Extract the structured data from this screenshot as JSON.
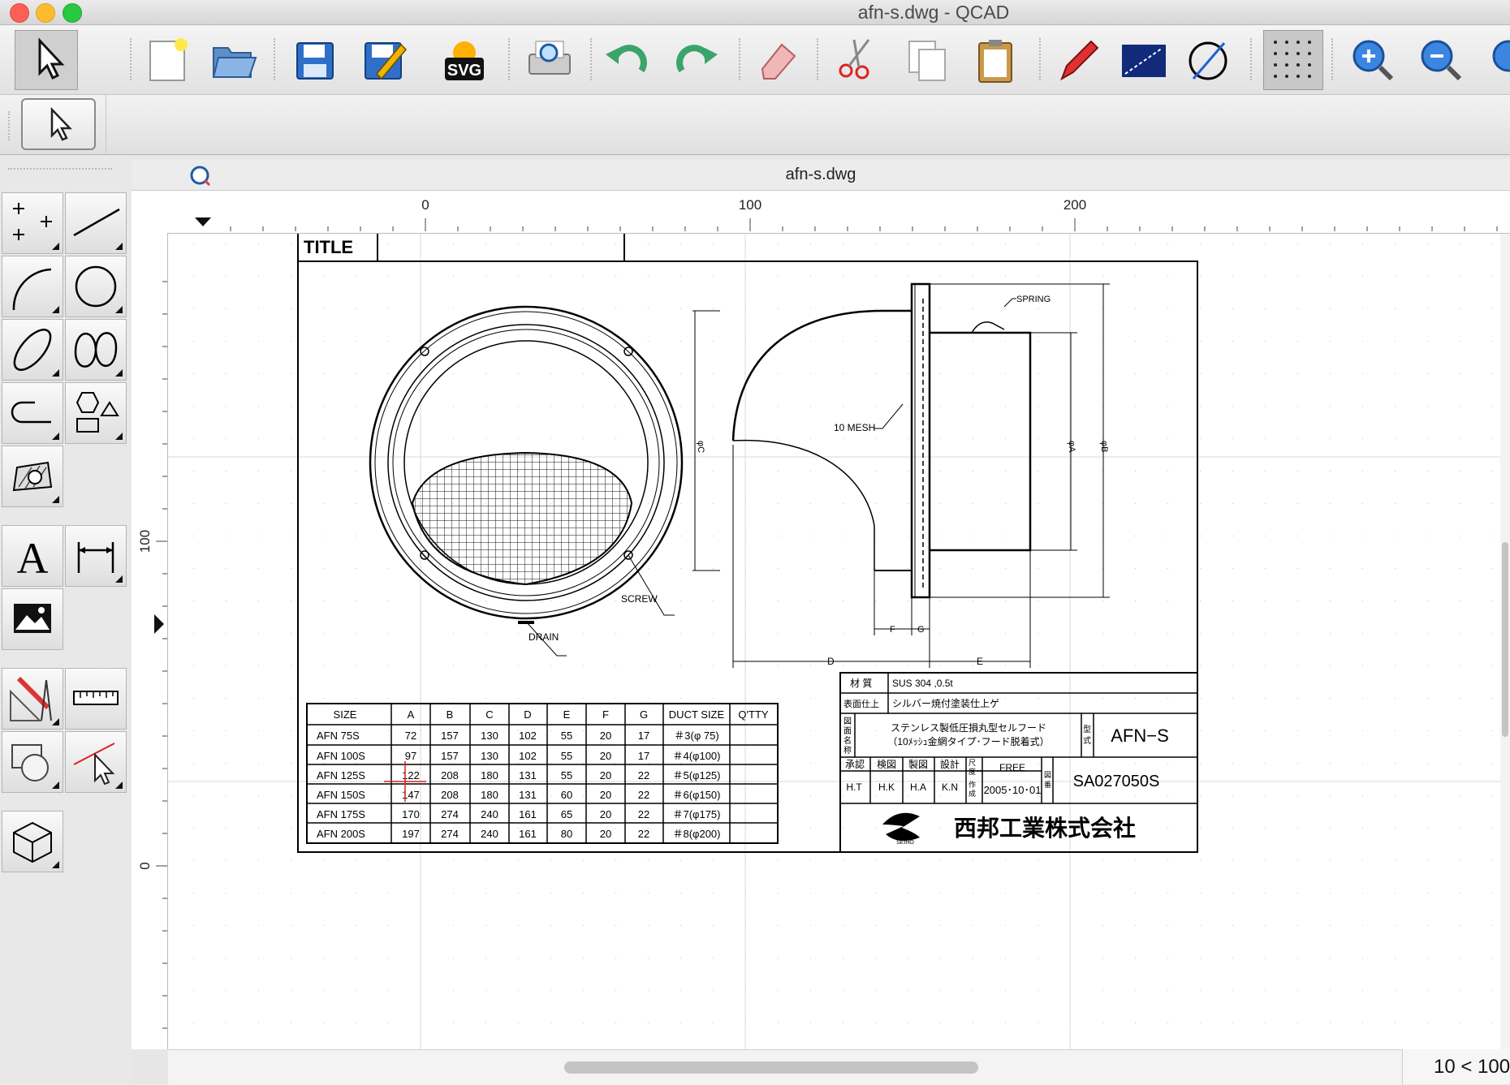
{
  "window": {
    "title": "afn-s.dwg - QCAD"
  },
  "document": {
    "tab_title": "afn-s.dwg"
  },
  "status": {
    "zoom_info": "10 < 100"
  },
  "ruler": {
    "h_labels": [
      "0",
      "100",
      "200"
    ],
    "v_labels": [
      "100",
      "0"
    ]
  },
  "toolbar": {
    "svg_label": "SVG"
  },
  "toolbox": {
    "text_tool_glyph": "A"
  },
  "drawing": {
    "title_label": "TITLE",
    "labels": {
      "spring": "SPRING",
      "mesh": "10 MESH",
      "screw": "SCREW",
      "drain": "DRAIN",
      "dim_c": "φC",
      "dim_a": "φA",
      "dim_b": "φB",
      "dim_d": "D",
      "dim_e": "E",
      "dim_f": "F",
      "dim_g": "G"
    },
    "table": {
      "headers": [
        "SIZE",
        "A",
        "B",
        "C",
        "D",
        "E",
        "F",
        "G",
        "DUCT SIZE",
        "Q'TTY"
      ],
      "rows": [
        [
          "AFN  75S",
          "72",
          "157",
          "130",
          "102",
          "55",
          "20",
          "17",
          "＃3(φ 75)",
          ""
        ],
        [
          "AFN 100S",
          "97",
          "157",
          "130",
          "102",
          "55",
          "20",
          "17",
          "＃4(φ100)",
          ""
        ],
        [
          "AFN 125S",
          "122",
          "208",
          "180",
          "131",
          "55",
          "20",
          "22",
          "＃5(φ125)",
          ""
        ],
        [
          "AFN 150S",
          "147",
          "208",
          "180",
          "131",
          "60",
          "20",
          "22",
          "＃6(φ150)",
          ""
        ],
        [
          "AFN 175S",
          "170",
          "274",
          "240",
          "161",
          "65",
          "20",
          "22",
          "＃7(φ175)",
          ""
        ],
        [
          "AFN 200S",
          "197",
          "274",
          "240",
          "161",
          "80",
          "20",
          "22",
          "＃8(φ200)",
          ""
        ]
      ]
    },
    "titleblock": {
      "material_label": "材 質",
      "material_value": "SUS 304 ,0.5t",
      "finish_label": "表面仕上",
      "finish_value": "シルバー焼付塗装仕上ゲ",
      "name_label_chars": [
        "図",
        "面",
        "名",
        "称"
      ],
      "name_line1": "ステンレス製低圧損丸型セルフード",
      "name_line2": "（10ﾒｯｼｭ金網タイプ･フード脱着式）",
      "model_label_chars": [
        "型",
        "式"
      ],
      "model_value": "AFN−S",
      "approval_headers": [
        "承認",
        "検図",
        "製図",
        "設計"
      ],
      "approval_values": [
        "H.T",
        "H.K",
        "H.A",
        "K.N"
      ],
      "scale_label_chars": [
        "尺",
        "度"
      ],
      "scale_value": "FREE",
      "date_label_chars": [
        "作",
        "成"
      ],
      "date_value": "2005･10･01",
      "drawing_no_label_chars": [
        "図",
        "番"
      ],
      "drawing_no": "SA027050S",
      "company": "西邦工業株式会社",
      "logo_text": "SEIHO"
    }
  },
  "colors": {
    "accent_blue": "#1e5fb4",
    "warn_yellow": "#ffd800",
    "red": "#d62020",
    "green_undo": "#39a36a"
  }
}
